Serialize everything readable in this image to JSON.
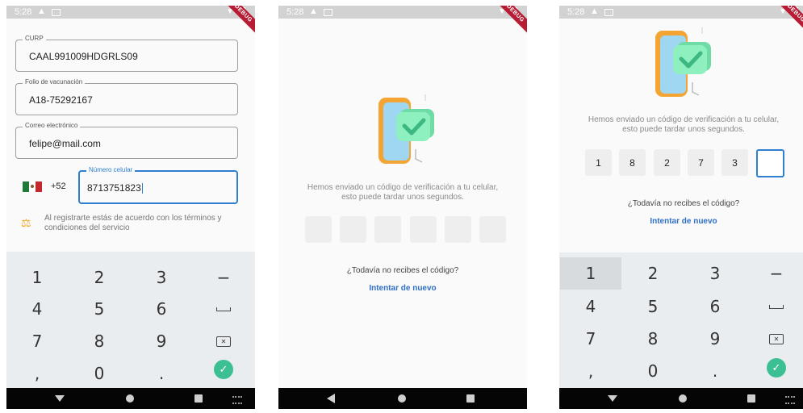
{
  "status": {
    "time": "5:28",
    "debug_label": "DEBUG"
  },
  "form": {
    "curp": {
      "label": "CURP",
      "value": "CAAL991009HDGRLS09"
    },
    "folio": {
      "label": "Folio de vacunación",
      "value": "A18-75292167"
    },
    "email": {
      "label": "Correo electrónico",
      "value": "felipe@mail.com"
    },
    "phone": {
      "label": "Número celular",
      "value": "8713751823",
      "country_code": "+52",
      "flag": "mexico-flag-icon"
    },
    "terms": "Al registrarte estás de acuerdo con los términos y condiciones del servicio"
  },
  "keypad": {
    "keys": [
      "1",
      "2",
      "3",
      "−",
      "4",
      "5",
      "6",
      "␣",
      "7",
      "8",
      "9",
      "⌫",
      ",",
      "0",
      ".",
      "✓"
    ]
  },
  "verification": {
    "message_line1": "Hemos enviado un código de verificación a tu celular,",
    "message_line2": "esto puede tardar unos segundos.",
    "question": "¿Todavía no recibes el código?",
    "retry": "Intentar de nuevo",
    "code_empty": [
      "",
      "",
      "",
      "",
      "",
      ""
    ],
    "code_entered": [
      "1",
      "8",
      "2",
      "7",
      "3",
      ""
    ]
  },
  "colors": {
    "accent": "#2f7fd1",
    "confirm": "#3dbf94",
    "link": "#2f6fc4"
  }
}
